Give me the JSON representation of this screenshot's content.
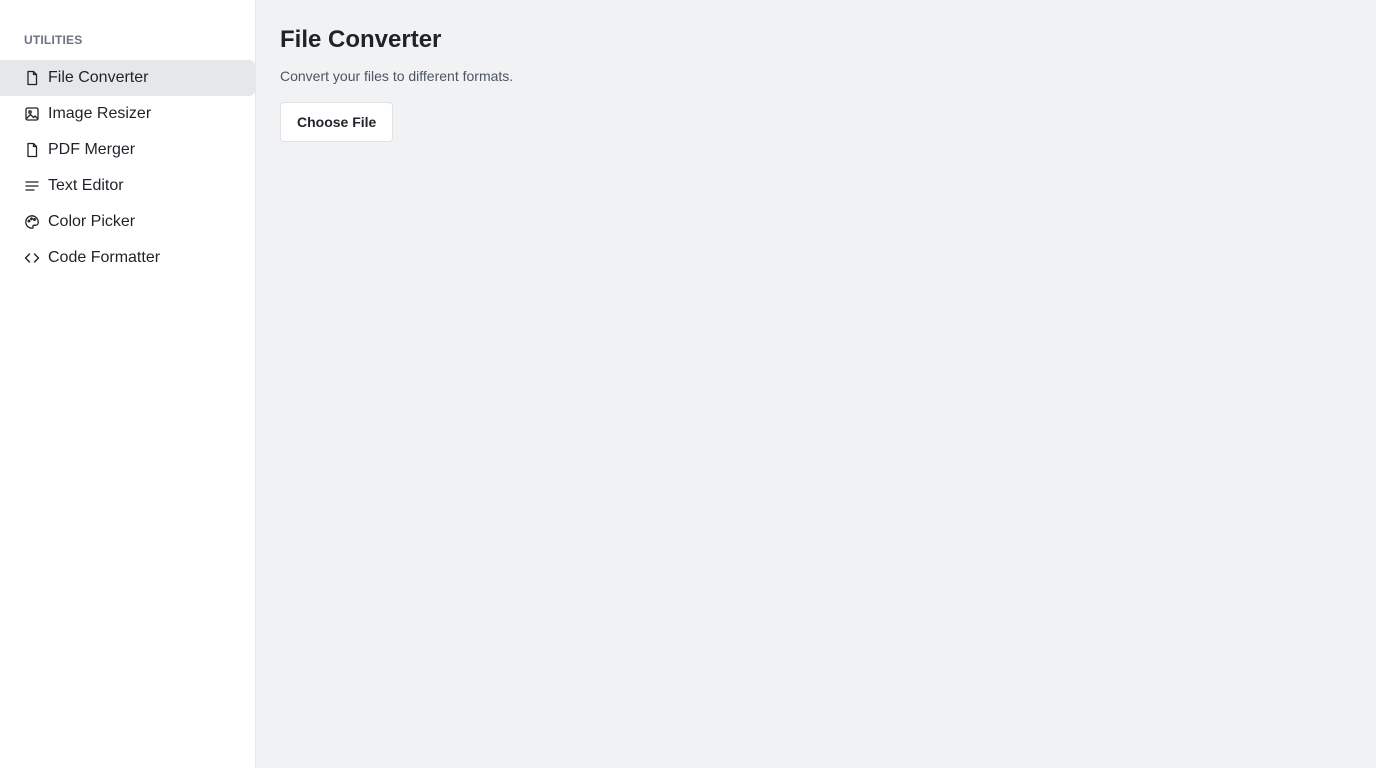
{
  "sidebar": {
    "heading": "UTILITIES",
    "items": [
      {
        "label": "File Converter",
        "icon": "file-icon",
        "active": true
      },
      {
        "label": "Image Resizer",
        "icon": "image-icon",
        "active": false
      },
      {
        "label": "PDF Merger",
        "icon": "file-icon",
        "active": false
      },
      {
        "label": "Text Editor",
        "icon": "text-lines-icon",
        "active": false
      },
      {
        "label": "Color Picker",
        "icon": "palette-icon",
        "active": false
      },
      {
        "label": "Code Formatter",
        "icon": "code-icon",
        "active": false
      }
    ]
  },
  "main": {
    "title": "File Converter",
    "subtitle": "Convert your files to different formats.",
    "choose_file_label": "Choose File"
  }
}
